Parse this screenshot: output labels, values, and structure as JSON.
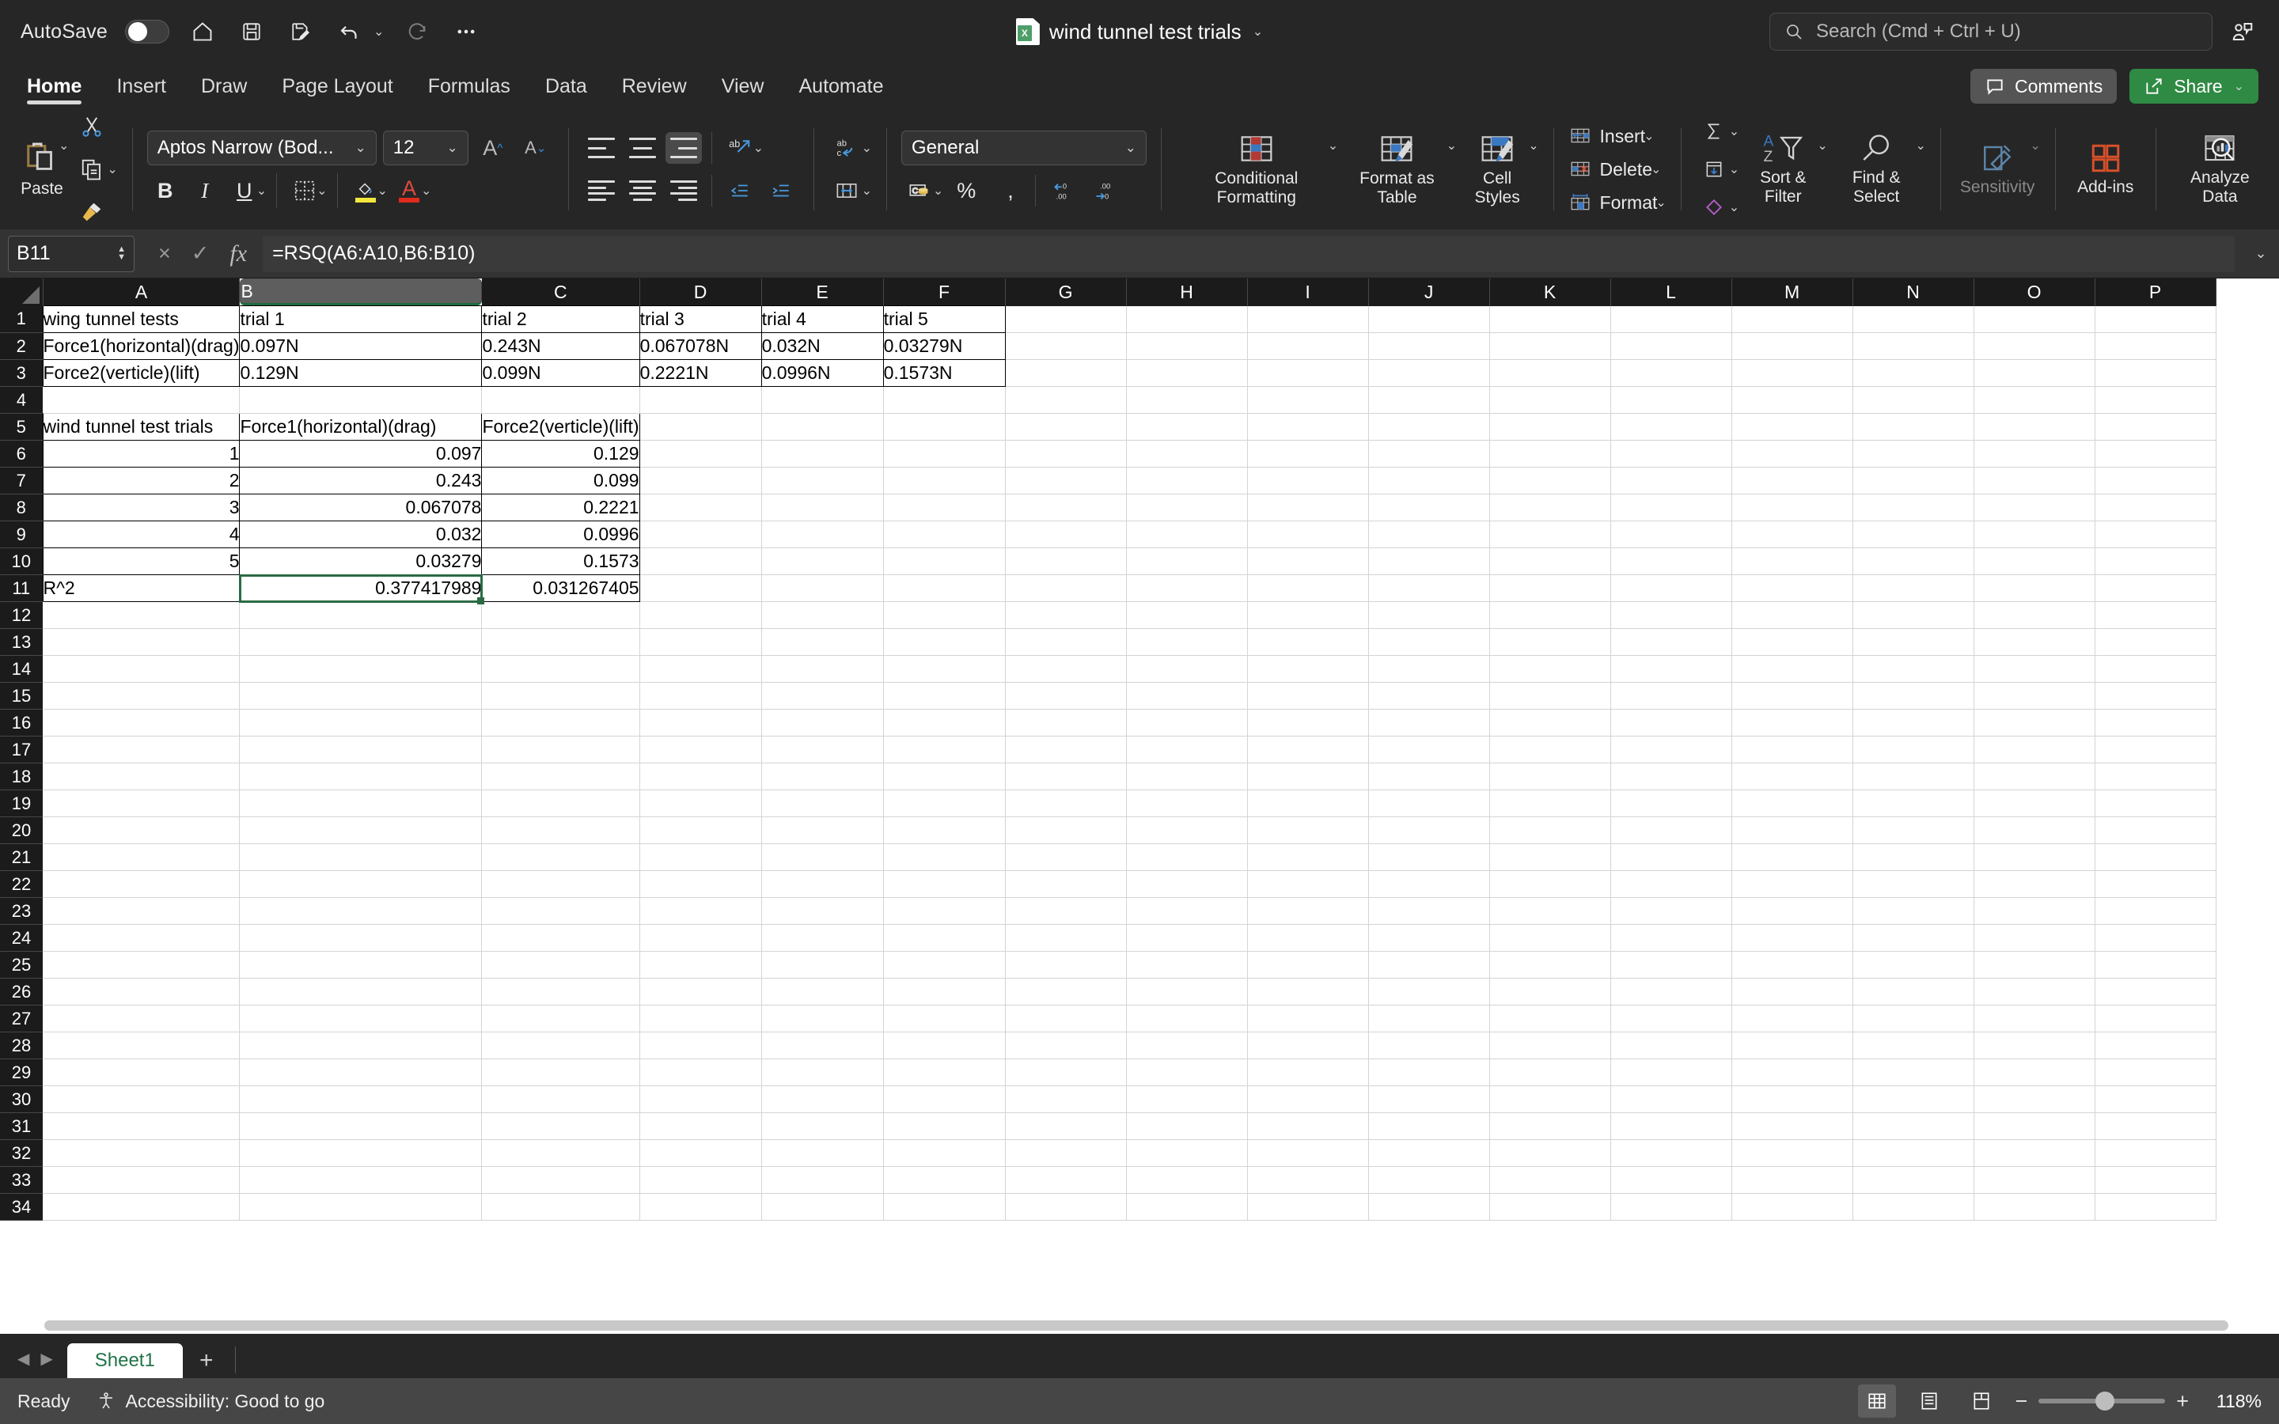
{
  "titlebar": {
    "autosave_label": "AutoSave",
    "autosave_state": "off",
    "doc_title": "wind tunnel test trials",
    "doc_icon_letter": "X",
    "quick_access": [
      {
        "name": "home-icon",
        "label": "Home"
      },
      {
        "name": "save-icon",
        "label": "Save"
      },
      {
        "name": "save-edit-icon",
        "label": "Save As"
      },
      {
        "name": "undo-icon",
        "label": "Undo"
      },
      {
        "name": "redo-icon",
        "label": "Redo"
      },
      {
        "name": "more-options-icon",
        "label": "More"
      }
    ],
    "search_placeholder": "Search (Cmd + Ctrl + U)"
  },
  "tabs": [
    {
      "label": "Home",
      "active": true
    },
    {
      "label": "Insert",
      "active": false
    },
    {
      "label": "Draw",
      "active": false
    },
    {
      "label": "Page Layout",
      "active": false
    },
    {
      "label": "Formulas",
      "active": false
    },
    {
      "label": "Data",
      "active": false
    },
    {
      "label": "Review",
      "active": false
    },
    {
      "label": "View",
      "active": false
    },
    {
      "label": "Automate",
      "active": false
    }
  ],
  "tab_actions": {
    "comments_label": "Comments",
    "share_label": "Share"
  },
  "ribbon": {
    "paste_label": "Paste",
    "font_name": "Aptos Narrow (Bod...",
    "font_size": "12",
    "number_format": "General",
    "conditional_formatting_label": "Conditional Formatting",
    "format_as_table_label": "Format as Table",
    "cell_styles_label": "Cell Styles",
    "insert_label": "Insert",
    "delete_label": "Delete",
    "format_label": "Format",
    "sort_filter_label": "Sort & Filter",
    "find_select_label": "Find & Select",
    "sensitivity_label": "Sensitivity",
    "addins_label": "Add-ins",
    "analyze_data_label": "Analyze Data"
  },
  "formula_bar": {
    "name_box": "B11",
    "formula": "=RSQ(A6:A10,B6:B10)",
    "cancel_icon": "×",
    "enter_icon": "✓",
    "fx_icon": "fx"
  },
  "grid": {
    "columns": [
      "A",
      "B",
      "C",
      "D",
      "E",
      "F",
      "G",
      "H",
      "I",
      "J",
      "K",
      "L",
      "M",
      "N",
      "O",
      "P"
    ],
    "selected_column": "B",
    "selected_cell": "B11",
    "row_count": 34,
    "rows": {
      "1": {
        "A": "wing tunnel  tests",
        "B": "trial 1",
        "C": "trial 2",
        "D": "trial 3",
        "E": "trial 4",
        "F": "trial 5"
      },
      "2": {
        "A": "Force1(horizontal)(drag)",
        "B": "0.097N",
        "C": "0.243N",
        "D": "0.067078N",
        "E": "0.032N",
        "F": "0.03279N"
      },
      "3": {
        "A": "Force2(verticle)(lift)",
        "B": "0.129N",
        "C": "0.099N",
        "D": "0.2221N",
        "E": "0.0996N",
        "F": "0.1573N"
      },
      "5": {
        "A": "wind tunnel test trials",
        "B": "Force1(horizontal)(drag)",
        "C": "Force2(verticle)(lift)"
      },
      "6": {
        "A": "1",
        "B": "0.097",
        "C": "0.129"
      },
      "7": {
        "A": "2",
        "B": "0.243",
        "C": "0.099"
      },
      "8": {
        "A": "3",
        "B": "0.067078",
        "C": "0.2221"
      },
      "9": {
        "A": "4",
        "B": "0.032",
        "C": "0.0996"
      },
      "10": {
        "A": "5",
        "B": "0.03279",
        "C": "0.1573"
      },
      "11": {
        "A": "R^2",
        "B": "0.377417989",
        "C": "0.031267405"
      }
    }
  },
  "sheetbar": {
    "sheets": [
      {
        "label": "Sheet1",
        "active": true
      }
    ],
    "add_sheet_icon": "+"
  },
  "statusbar": {
    "ready_label": "Ready",
    "accessibility_label": "Accessibility: Good to go",
    "zoom_label": "118%",
    "zoom_out_icon": "−",
    "zoom_in_icon": "+"
  },
  "colors": {
    "accent_green": "#217346",
    "share_green": "#2f8a43",
    "selection_green": "#2a6b43",
    "ribbon_bg": "#262626",
    "status_bg": "#464646"
  }
}
